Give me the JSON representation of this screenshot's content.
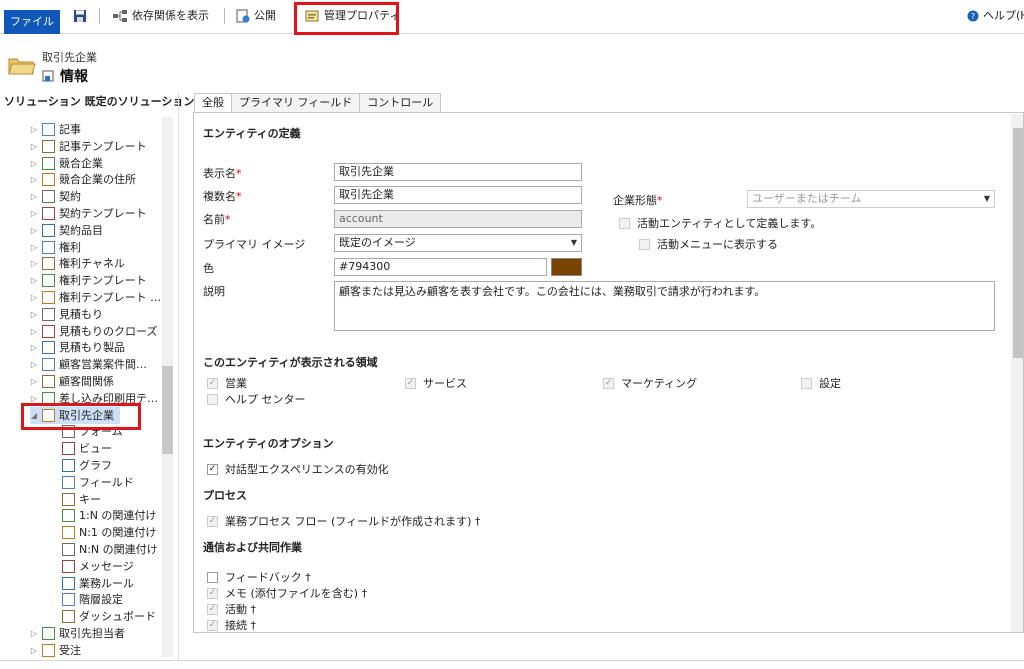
{
  "ribbon": {
    "file": "ファイル",
    "dependencies": "依存関係を表示",
    "publish": "公開",
    "manage_properties": "管理プロパティ",
    "help": "ヘルプ(H)"
  },
  "header": {
    "subtitle": "取引先企業",
    "title": "情報"
  },
  "nav": {
    "heading": "ソリューション 既定のソリューション",
    "items": [
      {
        "label": "記事",
        "icon": "article-icon",
        "expander": "▷"
      },
      {
        "label": "記事テンプレート",
        "icon": "template-icon",
        "expander": "▷"
      },
      {
        "label": "競合企業",
        "icon": "competitor-icon",
        "expander": "▷"
      },
      {
        "label": "競合企業の住所",
        "icon": "address-icon",
        "expander": "▷"
      },
      {
        "label": "契約",
        "icon": "contract-icon",
        "expander": "▷"
      },
      {
        "label": "契約テンプレート",
        "icon": "contract-template-icon",
        "expander": "▷"
      },
      {
        "label": "契約品目",
        "icon": "contract-line-icon",
        "expander": "▷"
      },
      {
        "label": "権利",
        "icon": "entitlement-icon",
        "expander": "▷"
      },
      {
        "label": "権利チャネル",
        "icon": "entitlement-channel-icon",
        "expander": "▷"
      },
      {
        "label": "権利テンプレート",
        "icon": "entitlement-template-icon",
        "expander": "▷"
      },
      {
        "label": "権利テンプレート …",
        "icon": "entitlement-template-icon",
        "expander": "▷"
      },
      {
        "label": "見積もり",
        "icon": "quote-icon",
        "expander": "▷"
      },
      {
        "label": "見積もりのクローズ",
        "icon": "quote-close-icon",
        "expander": "▷"
      },
      {
        "label": "見積もり製品",
        "icon": "quote-product-icon",
        "expander": "▷"
      },
      {
        "label": "顧客営業案件間…",
        "icon": "customer-opportunity-icon",
        "expander": "▷"
      },
      {
        "label": "顧客間関係",
        "icon": "customer-relationship-icon",
        "expander": "▷"
      },
      {
        "label": "差し込み印刷用テ…",
        "icon": "mailmerge-icon",
        "expander": "▷"
      },
      {
        "label": "取引先企業",
        "icon": "account-icon",
        "expander": "◢"
      },
      {
        "label": "フォーム",
        "icon": "form-icon",
        "expander": ""
      },
      {
        "label": "ビュー",
        "icon": "view-icon",
        "expander": ""
      },
      {
        "label": "グラフ",
        "icon": "chart-icon",
        "expander": ""
      },
      {
        "label": "フィールド",
        "icon": "field-icon",
        "expander": ""
      },
      {
        "label": "キー",
        "icon": "key-icon",
        "expander": ""
      },
      {
        "label": "1:N の関連付け",
        "icon": "relationship-1n-icon",
        "expander": ""
      },
      {
        "label": "N:1 の関連付け",
        "icon": "relationship-n1-icon",
        "expander": ""
      },
      {
        "label": "N:N の関連付け",
        "icon": "relationship-nn-icon",
        "expander": ""
      },
      {
        "label": "メッセージ",
        "icon": "message-icon",
        "expander": ""
      },
      {
        "label": "業務ルール",
        "icon": "business-rule-icon",
        "expander": ""
      },
      {
        "label": "階層設定",
        "icon": "hierarchy-icon",
        "expander": ""
      },
      {
        "label": "ダッシュボード",
        "icon": "dashboard-icon",
        "expander": ""
      },
      {
        "label": "取引先担当者",
        "icon": "contact-icon",
        "expander": "▷"
      },
      {
        "label": "受注",
        "icon": "order-icon",
        "expander": "▷"
      }
    ]
  },
  "tabs": [
    "全般",
    "プライマリ フィールド",
    "コントロール"
  ],
  "form": {
    "entity_definition": "エンティティの定義",
    "display_name_label": "表示名",
    "display_name": "取引先企業",
    "plural_name_label": "複数名",
    "plural_name": "取引先企業",
    "name_label": "名前",
    "name": "account",
    "primary_image_label": "プライマリ イメージ",
    "primary_image": "既定のイメージ",
    "color_label": "色",
    "color": "#794300",
    "description_label": "説明",
    "description": "顧客または見込み顧客を表す会社です。この会社には、業務取引で請求が行われます。",
    "ownership_label": "企業形態",
    "ownership": "ユーザーまたはチーム",
    "activity_entity": "活動エンティティとして定義します。",
    "activity_menu": "活動メニューに表示する",
    "areas_heading": "このエンティティが表示される領域",
    "areas": [
      {
        "label": "営業",
        "checked": true
      },
      {
        "label": "サービス",
        "checked": true
      },
      {
        "label": "マーケティング",
        "checked": true
      },
      {
        "label": "設定",
        "checked": false
      },
      {
        "label": "ヘルプ センター",
        "checked": false
      }
    ],
    "options_heading": "エンティティのオプション",
    "interactive": "対話型エクスペリエンスの有効化",
    "process_heading": "プロセス",
    "bpf": "業務プロセス フロー (フィールドが作成されます) †",
    "comm_heading": "通信および共同作業",
    "comm": [
      {
        "label": "フィードバック †",
        "checked": false
      },
      {
        "label": "メモ (添付ファイルを含む) †",
        "checked": true
      },
      {
        "label": "活動 †",
        "checked": true
      },
      {
        "label": "接続 †",
        "checked": true
      }
    ]
  }
}
